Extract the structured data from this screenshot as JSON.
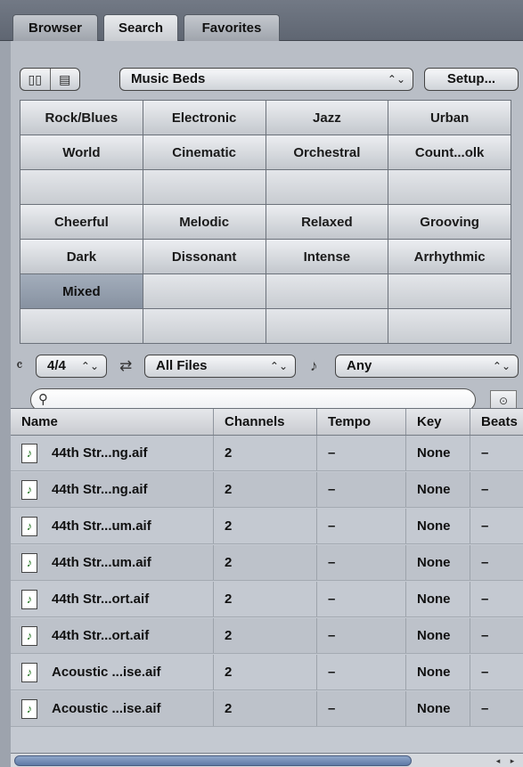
{
  "tabs": [
    "Browser",
    "Search",
    "Favorites"
  ],
  "active_tab": "Search",
  "toolbar": {
    "view_column_icon": "column-view-icon",
    "view_list_icon": "list-view-icon",
    "category_popup": "Music Beds",
    "setup_button": "Setup..."
  },
  "keywords": [
    [
      "Rock/Blues",
      "Electronic",
      "Jazz",
      "Urban"
    ],
    [
      "World",
      "Cinematic",
      "Orchestral",
      "Count...olk"
    ],
    [
      "",
      "",
      "",
      ""
    ],
    [
      "Cheerful",
      "Melodic",
      "Relaxed",
      "Grooving"
    ],
    [
      "Dark",
      "Dissonant",
      "Intense",
      "Arrhythmic"
    ],
    [
      "Mixed",
      "",
      "",
      ""
    ]
  ],
  "selected_keyword": "Mixed",
  "filters": {
    "signature_icon": "time-signature-icon",
    "signature_value": "4/4",
    "loop_icon": "loop-icon",
    "files_value": "All Files",
    "scale_icon": "scale-icon",
    "scale_value": "Any"
  },
  "search": {
    "placeholder": "",
    "icon": "search-icon"
  },
  "columns": [
    "Name",
    "Channels",
    "Tempo",
    "Key",
    "Beats"
  ],
  "rows": [
    {
      "name": "44th Str...ng.aif",
      "channels": "2",
      "tempo": "–",
      "key": "None",
      "beats": "–"
    },
    {
      "name": "44th Str...ng.aif",
      "channels": "2",
      "tempo": "–",
      "key": "None",
      "beats": "–"
    },
    {
      "name": "44th Str...um.aif",
      "channels": "2",
      "tempo": "–",
      "key": "None",
      "beats": "–"
    },
    {
      "name": "44th Str...um.aif",
      "channels": "2",
      "tempo": "–",
      "key": "None",
      "beats": "–"
    },
    {
      "name": "44th Str...ort.aif",
      "channels": "2",
      "tempo": "–",
      "key": "None",
      "beats": "–"
    },
    {
      "name": "44th Str...ort.aif",
      "channels": "2",
      "tempo": "–",
      "key": "None",
      "beats": "–"
    },
    {
      "name": "Acoustic ...ise.aif",
      "channels": "2",
      "tempo": "–",
      "key": "None",
      "beats": "–"
    },
    {
      "name": "Acoustic ...ise.aif",
      "channels": "2",
      "tempo": "–",
      "key": "None",
      "beats": "–"
    }
  ]
}
